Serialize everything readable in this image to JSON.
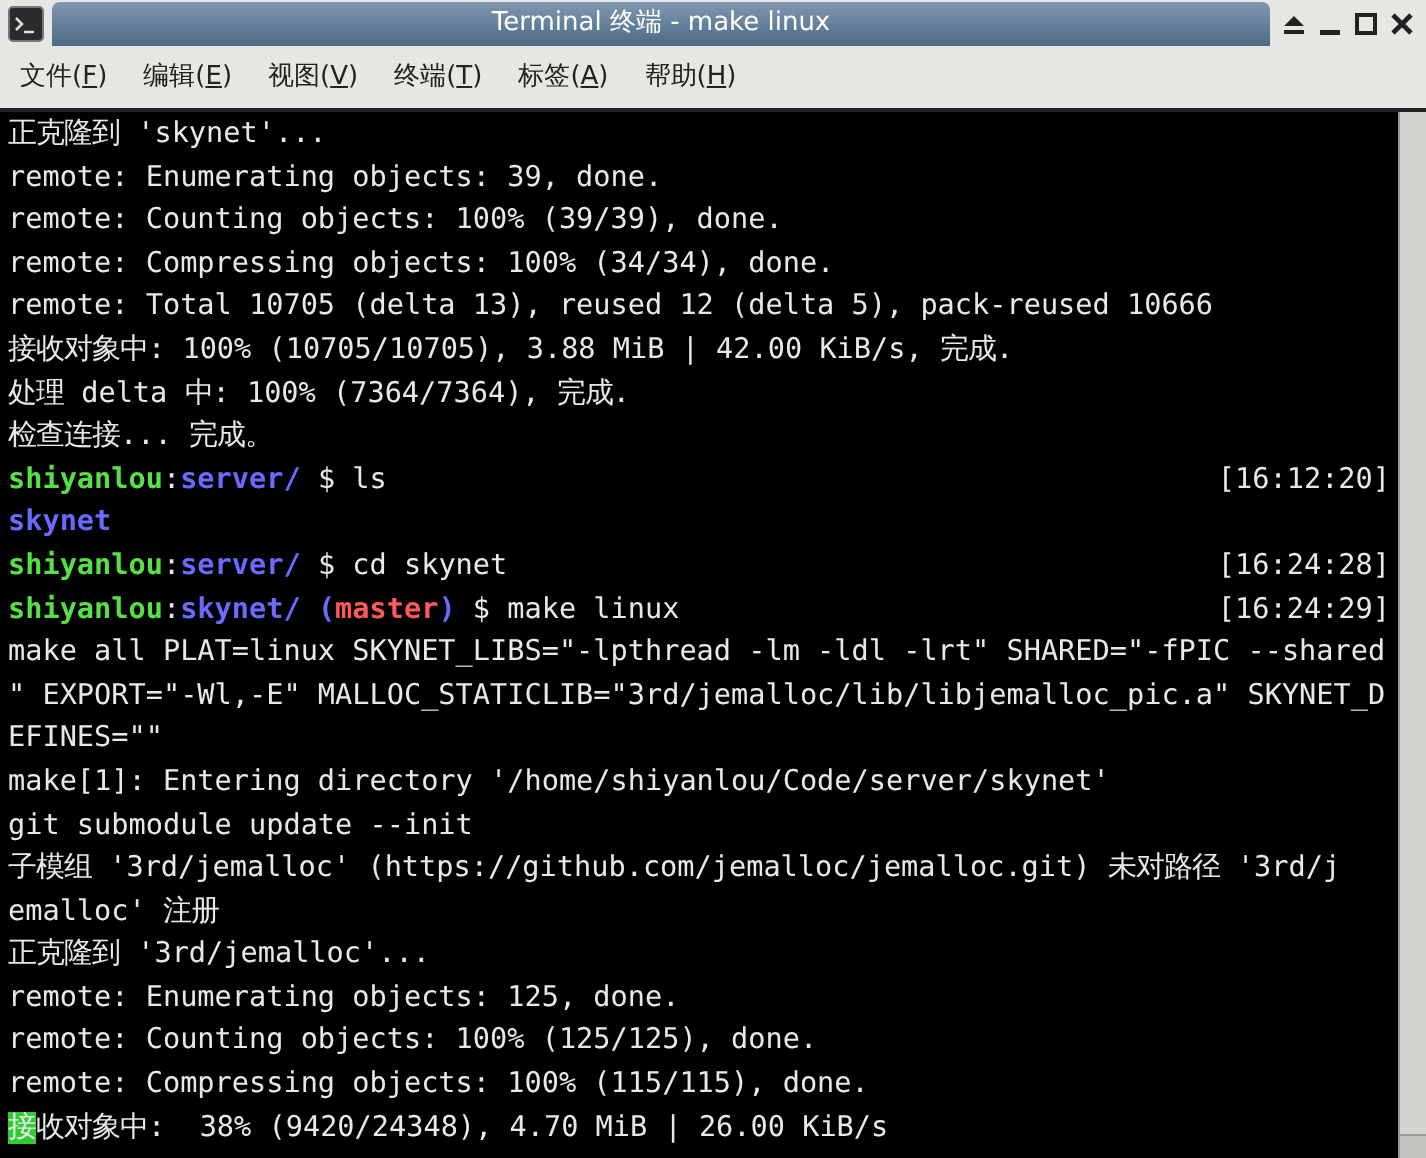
{
  "window": {
    "title": "Terminal 终端 - make linux"
  },
  "menu": [
    {
      "before": "文件(",
      "key": "F",
      "after": ")"
    },
    {
      "before": "编辑(",
      "key": "E",
      "after": ")"
    },
    {
      "before": "视图(",
      "key": "V",
      "after": ")"
    },
    {
      "before": "终端(",
      "key": "T",
      "after": ")"
    },
    {
      "before": "标签(",
      "key": "A",
      "after": ")"
    },
    {
      "before": "帮助(",
      "key": "H",
      "after": ")"
    }
  ],
  "terminal": {
    "lines": [
      {
        "segments": [
          {
            "kind": "text",
            "text": "正克隆到 'skynet'..."
          }
        ]
      },
      {
        "segments": [
          {
            "kind": "text",
            "text": "remote: Enumerating objects: 39, done."
          }
        ]
      },
      {
        "segments": [
          {
            "kind": "text",
            "text": "remote: Counting objects: 100% (39/39), done."
          }
        ]
      },
      {
        "segments": [
          {
            "kind": "text",
            "text": "remote: Compressing objects: 100% (34/34), done."
          }
        ]
      },
      {
        "segments": [
          {
            "kind": "text",
            "text": "remote: Total 10705 (delta 13), reused 12 (delta 5), pack-reused 10666"
          }
        ]
      },
      {
        "segments": [
          {
            "kind": "text",
            "text": "接收对象中: 100% (10705/10705), 3.88 MiB | 42.00 KiB/s, 完成."
          }
        ]
      },
      {
        "segments": [
          {
            "kind": "text",
            "text": "处理 delta 中: 100% (7364/7364), 完成."
          }
        ]
      },
      {
        "segments": [
          {
            "kind": "text",
            "text": "检查连接... 完成。"
          }
        ]
      },
      {
        "segments": [
          {
            "kind": "user",
            "text": "shiyanlou"
          },
          {
            "kind": "text",
            "text": ":"
          },
          {
            "kind": "path",
            "text": "server/"
          },
          {
            "kind": "text",
            "text": " $ ls"
          }
        ],
        "time": "[16:12:20]"
      },
      {
        "segments": [
          {
            "kind": "path",
            "text": "skynet"
          }
        ]
      },
      {
        "segments": [
          {
            "kind": "user",
            "text": "shiyanlou"
          },
          {
            "kind": "text",
            "text": ":"
          },
          {
            "kind": "path",
            "text": "server/"
          },
          {
            "kind": "text",
            "text": " $ cd skynet"
          }
        ],
        "time": "[16:24:28]"
      },
      {
        "segments": [
          {
            "kind": "user",
            "text": "shiyanlou"
          },
          {
            "kind": "text",
            "text": ":"
          },
          {
            "kind": "path",
            "text": "skynet/ ("
          },
          {
            "kind": "branch",
            "text": "master"
          },
          {
            "kind": "path",
            "text": ")"
          },
          {
            "kind": "text",
            "text": " $ make linux"
          }
        ],
        "time": "[16:24:29]"
      },
      {
        "segments": [
          {
            "kind": "text",
            "text": "make all PLAT=linux SKYNET_LIBS=\"-lpthread -lm -ldl -lrt\" SHARED=\"-fPIC --shared"
          }
        ]
      },
      {
        "segments": [
          {
            "kind": "text",
            "text": "\" EXPORT=\"-Wl,-E\" MALLOC_STATICLIB=\"3rd/jemalloc/lib/libjemalloc_pic.a\" SKYNET_D"
          }
        ]
      },
      {
        "segments": [
          {
            "kind": "text",
            "text": "EFINES=\"\""
          }
        ]
      },
      {
        "segments": [
          {
            "kind": "text",
            "text": "make[1]: Entering directory '/home/shiyanlou/Code/server/skynet'"
          }
        ]
      },
      {
        "segments": [
          {
            "kind": "text",
            "text": "git submodule update --init"
          }
        ]
      },
      {
        "segments": [
          {
            "kind": "text",
            "text": "子模组 '3rd/jemalloc' (https://github.com/jemalloc/jemalloc.git) 未对路径 '3rd/j"
          }
        ]
      },
      {
        "segments": [
          {
            "kind": "text",
            "text": "emalloc' 注册"
          }
        ]
      },
      {
        "segments": [
          {
            "kind": "text",
            "text": "正克隆到 '3rd/jemalloc'..."
          }
        ]
      },
      {
        "segments": [
          {
            "kind": "text",
            "text": "remote: Enumerating objects: 125, done."
          }
        ]
      },
      {
        "segments": [
          {
            "kind": "text",
            "text": "remote: Counting objects: 100% (125/125), done."
          }
        ]
      },
      {
        "segments": [
          {
            "kind": "text",
            "text": "remote: Compressing objects: 100% (115/115), done."
          }
        ]
      },
      {
        "segments": [
          {
            "kind": "cursor",
            "text": "接"
          },
          {
            "kind": "text",
            "text": "收对象中:  38% (9420/24348), 4.70 MiB | 26.00 KiB/s"
          }
        ]
      }
    ]
  }
}
